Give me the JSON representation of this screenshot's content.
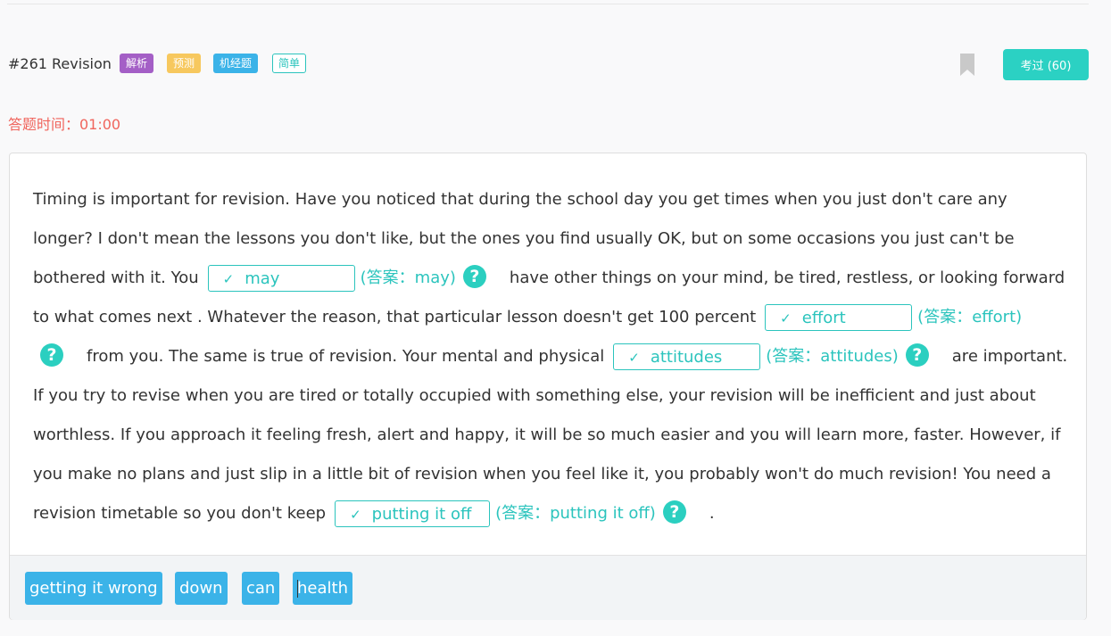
{
  "header": {
    "question_title": "#261 Revision",
    "tags": [
      "解析",
      "预测",
      "机经题",
      "简单"
    ],
    "exam_button": "考过 (60)",
    "bookmark_icon": "bookmark-icon"
  },
  "timer": "答题时间：01:00",
  "passage": {
    "segments": [
      "Timing is important for revision. Have you noticed that during the school day you get times when you just don't care any longer? I don't mean the lessons you don't like, but the ones you find usually OK, but on some occasions you just can't be bothered with it. You",
      "have other things on your mind, be tired, restless, or looking forward to what comes next . Whatever the reason, that particular lesson doesn't get 100 percent",
      "from you. The same is true of revision. Your mental and physical",
      "are important. If you try to revise when you are tired or totally occupied with something else, your revision will be inefficient and just about worthless. If you approach it feeling fresh, alert and happy, it will be so much easier and you will learn more, faster. However, if you make no plans and just slip in a little bit of revision when you feel like it, you probably won't do much revision! You need a revision timetable so you don't keep",
      "."
    ],
    "blanks": [
      {
        "value": "may",
        "answer": "(答案：may)"
      },
      {
        "value": "effort",
        "answer": "(答案：effort)"
      },
      {
        "value": "attitudes",
        "answer": "(答案：attitudes)"
      },
      {
        "value": "putting it off",
        "answer": "(答案：putting it off)"
      }
    ],
    "check_mark": "✓",
    "help_symbol": "?"
  },
  "word_bank": [
    "getting it wrong",
    "down",
    "can",
    "health"
  ],
  "colors": {
    "accent": "#2bc4bd",
    "timer": "#f0655d",
    "word_chip": "#3bb3e8",
    "tag_purple": "#a45fc6",
    "tag_yellow": "#f7c85e",
    "tag_blue": "#3bb3e8"
  }
}
